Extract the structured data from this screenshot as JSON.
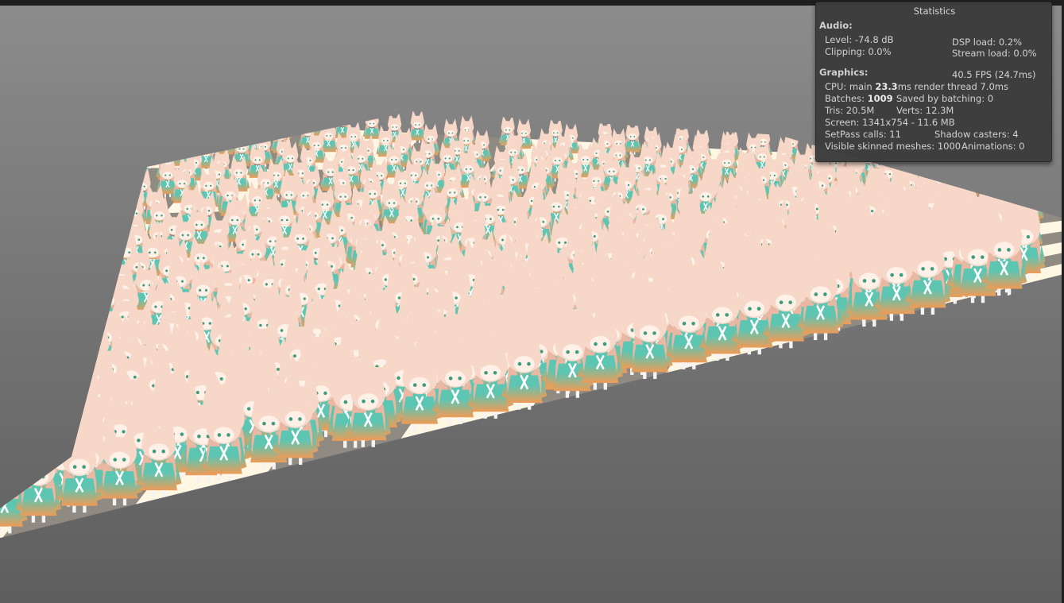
{
  "stats": {
    "title": "Statistics",
    "audio": {
      "header": "Audio:",
      "level": "Level: -74.8 dB",
      "clipping": "Clipping: 0.0%",
      "dsp_load": "DSP load: 0.2%",
      "stream_load": "Stream load: 0.0%"
    },
    "graphics": {
      "header": "Graphics:",
      "fps": "40.5 FPS (24.7ms)",
      "cpu_prefix": "CPU: main ",
      "cpu_main": "23.3",
      "cpu_suffix": "ms  render thread 7.0ms",
      "batches_prefix": "Batches: ",
      "batches": "1009",
      "saved_by_batching": "Saved by batching: 0",
      "tris": "Tris: 20.5M",
      "verts": "Verts: 12.3M",
      "screen": "Screen: 1341x754 - 11.6 MB",
      "setpass": "SetPass calls: 11",
      "shadow_casters": "Shadow casters: 4",
      "visible_skinned": "Visible skinned meshes: 1000",
      "animations": "Animations: 0"
    }
  },
  "scene": {
    "character_count": 1000,
    "colors": {
      "background_top": "#8c8c8c",
      "background_bottom": "#5e5e5e",
      "floor_light": "#fff6e4",
      "floor_dark": "#8f8a82",
      "hair": "#f6d7c8",
      "hair_shadow": "#e9b7a2",
      "dress_top": "#5cc6b3",
      "dress_bottom": "#ef9b56",
      "ribbon": "#ffffff"
    }
  }
}
